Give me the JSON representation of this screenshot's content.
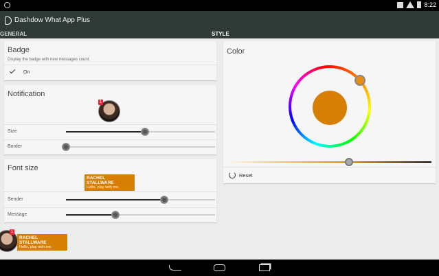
{
  "statusbar": {
    "time": "8:22"
  },
  "app": {
    "title": "Dashdow What App Plus"
  },
  "tabs": [
    {
      "label": "GENERAL"
    },
    {
      "label": "STYLE"
    }
  ],
  "badge_card": {
    "title": "Badge",
    "description": "Display the badge with new messages count.",
    "toggle_label": "On",
    "toggle_checked": true
  },
  "notification_card": {
    "title": "Notification",
    "badge_count": "1",
    "sliders": [
      {
        "label": "Size",
        "value": 0.53
      },
      {
        "label": "Border",
        "value": 0.0
      }
    ]
  },
  "fontsize_card": {
    "title": "Font size",
    "preview": {
      "name": "RACHEL STALLWARE",
      "message": "Hello, play with me."
    },
    "sliders": [
      {
        "label": "Sender",
        "value": 0.66
      },
      {
        "label": "Message",
        "value": 0.33
      }
    ]
  },
  "floating_preview": {
    "badge_count": "1",
    "name": "RACHEL STALLWARE",
    "message": "Hello, play with me."
  },
  "color_card": {
    "title": "Color",
    "selected_color": "#d77e05",
    "value_slider": 0.59,
    "reset_label": "Reset"
  },
  "colors": {
    "actionbar": "#2f3a36",
    "accent": "#d77e05",
    "badge": "#ee2233"
  }
}
